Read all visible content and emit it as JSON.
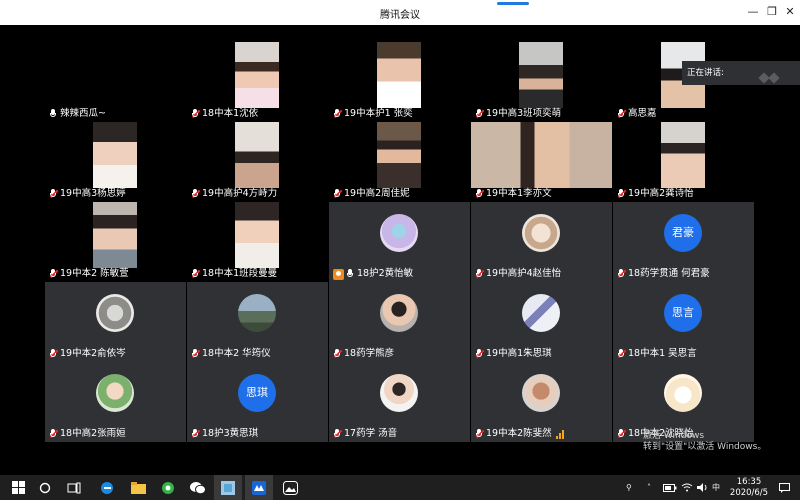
{
  "window": {
    "title": "腾讯会议",
    "minimize": "—",
    "restore": "❐",
    "close": "✕"
  },
  "speaking": {
    "label": "正在讲话:"
  },
  "participants": [
    {
      "name": "辣辣西瓜~",
      "mic": "on"
    },
    {
      "name": "18中本1沈依",
      "mic": "muted"
    },
    {
      "name": "19中本护1 张奕",
      "mic": "muted"
    },
    {
      "name": "19中高3班项奕萌",
      "mic": "muted"
    },
    {
      "name": "高思嘉",
      "mic": "muted"
    },
    {
      "name": "19中高3杨思婷",
      "mic": "muted"
    },
    {
      "name": "19中高护4方峙力",
      "mic": "muted"
    },
    {
      "name": "19中高2周佳妮",
      "mic": "muted"
    },
    {
      "name": "19中本1李亦文",
      "mic": "muted"
    },
    {
      "name": "19中高2龚诗怡",
      "mic": "muted"
    },
    {
      "name": "19中本2 陈敏萱",
      "mic": "muted"
    },
    {
      "name": "18中本1班段曼曼",
      "mic": "muted"
    },
    {
      "name": "18护2黄怡敏",
      "mic": "on",
      "host": true
    },
    {
      "name": "19中高护4赵佳怡",
      "mic": "muted"
    },
    {
      "name": "18药学贯通 何君豪",
      "mic": "muted",
      "avatar_text": "君豪"
    },
    {
      "name": "19中本2俞依岑",
      "mic": "muted"
    },
    {
      "name": "18中本2 华筠仪",
      "mic": "muted"
    },
    {
      "name": "18药学熊彦",
      "mic": "muted"
    },
    {
      "name": "19中高1朱思琪",
      "mic": "muted"
    },
    {
      "name": "18中本1 吴思言",
      "mic": "muted",
      "avatar_text": "思言"
    },
    {
      "name": "18中高2张雨姮",
      "mic": "muted"
    },
    {
      "name": "18护3黄思琪",
      "mic": "muted",
      "avatar_text": "思琪"
    },
    {
      "name": "17药学 汤音",
      "mic": "muted"
    },
    {
      "name": "19中本2陈斐然",
      "mic": "muted",
      "speaking": true
    },
    {
      "name": "18中本2沈晓怡",
      "mic": "muted"
    }
  ],
  "watermark": {
    "line1": "激活 Windows",
    "line2": "转到\"设置\"以激活 Windows。"
  },
  "taskbar": {
    "ime": "中",
    "time": "16:35",
    "date": "2020/6/5"
  },
  "colors": {
    "accent": "#1e6fe9",
    "tile_bg": "#303134",
    "mute": "#e02a2a",
    "host": "#f08a1c"
  }
}
